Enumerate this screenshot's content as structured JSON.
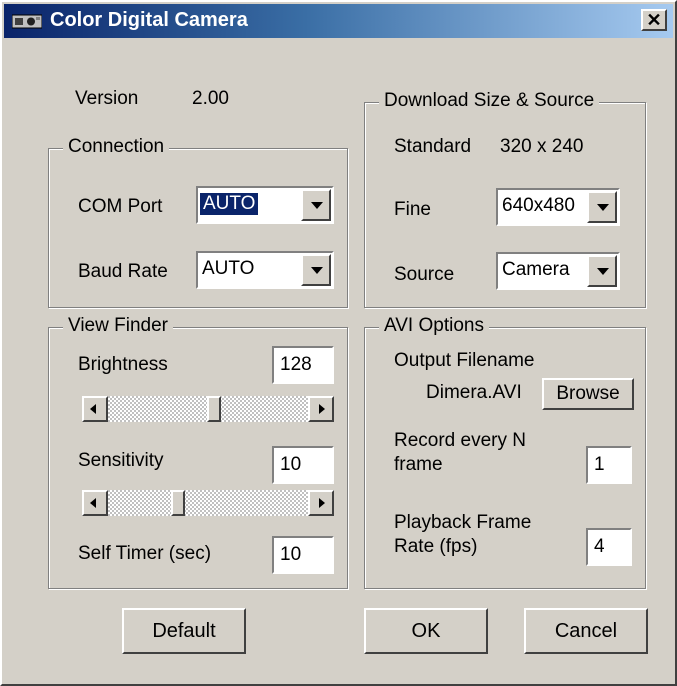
{
  "window": {
    "title": "Color Digital Camera",
    "close_glyph": "✕",
    "icon": "camera-icon"
  },
  "version": {
    "label": "Version",
    "value": "2.00"
  },
  "connection": {
    "group_title": "Connection",
    "com_port": {
      "label": "COM Port",
      "value": "AUTO"
    },
    "baud_rate": {
      "label": "Baud Rate",
      "value": "AUTO"
    }
  },
  "download": {
    "group_title": "Download Size & Source",
    "standard": {
      "label": "Standard",
      "value": "320 x 240"
    },
    "fine": {
      "label": "Fine",
      "value": "640x480"
    },
    "source": {
      "label": "Source",
      "value": "Camera"
    }
  },
  "view_finder": {
    "group_title": "View Finder",
    "brightness": {
      "label": "Brightness",
      "value": "128"
    },
    "brightness_slider_position": 0.53,
    "sensitivity": {
      "label": "Sensitivity",
      "value": "10"
    },
    "sensitivity_slider_position": 0.34,
    "self_timer": {
      "label": "Self Timer (sec)",
      "value": "10"
    }
  },
  "avi": {
    "group_title": "AVI Options",
    "output_label": "Output Filename",
    "filename": "Dimera.AVI",
    "browse_label": "Browse",
    "record_label_line1": "Record every N",
    "record_label_line2": "frame",
    "record_value": "1",
    "playback_label_line1": "Playback Frame",
    "playback_label_line2": "Rate (fps)",
    "playback_value": "4"
  },
  "buttons": {
    "default": "Default",
    "ok": "OK",
    "cancel": "Cancel"
  },
  "colors": {
    "dialog_bg": "#d4d0c8",
    "title_bar": "#0a246a",
    "selection": "#0a246a"
  }
}
